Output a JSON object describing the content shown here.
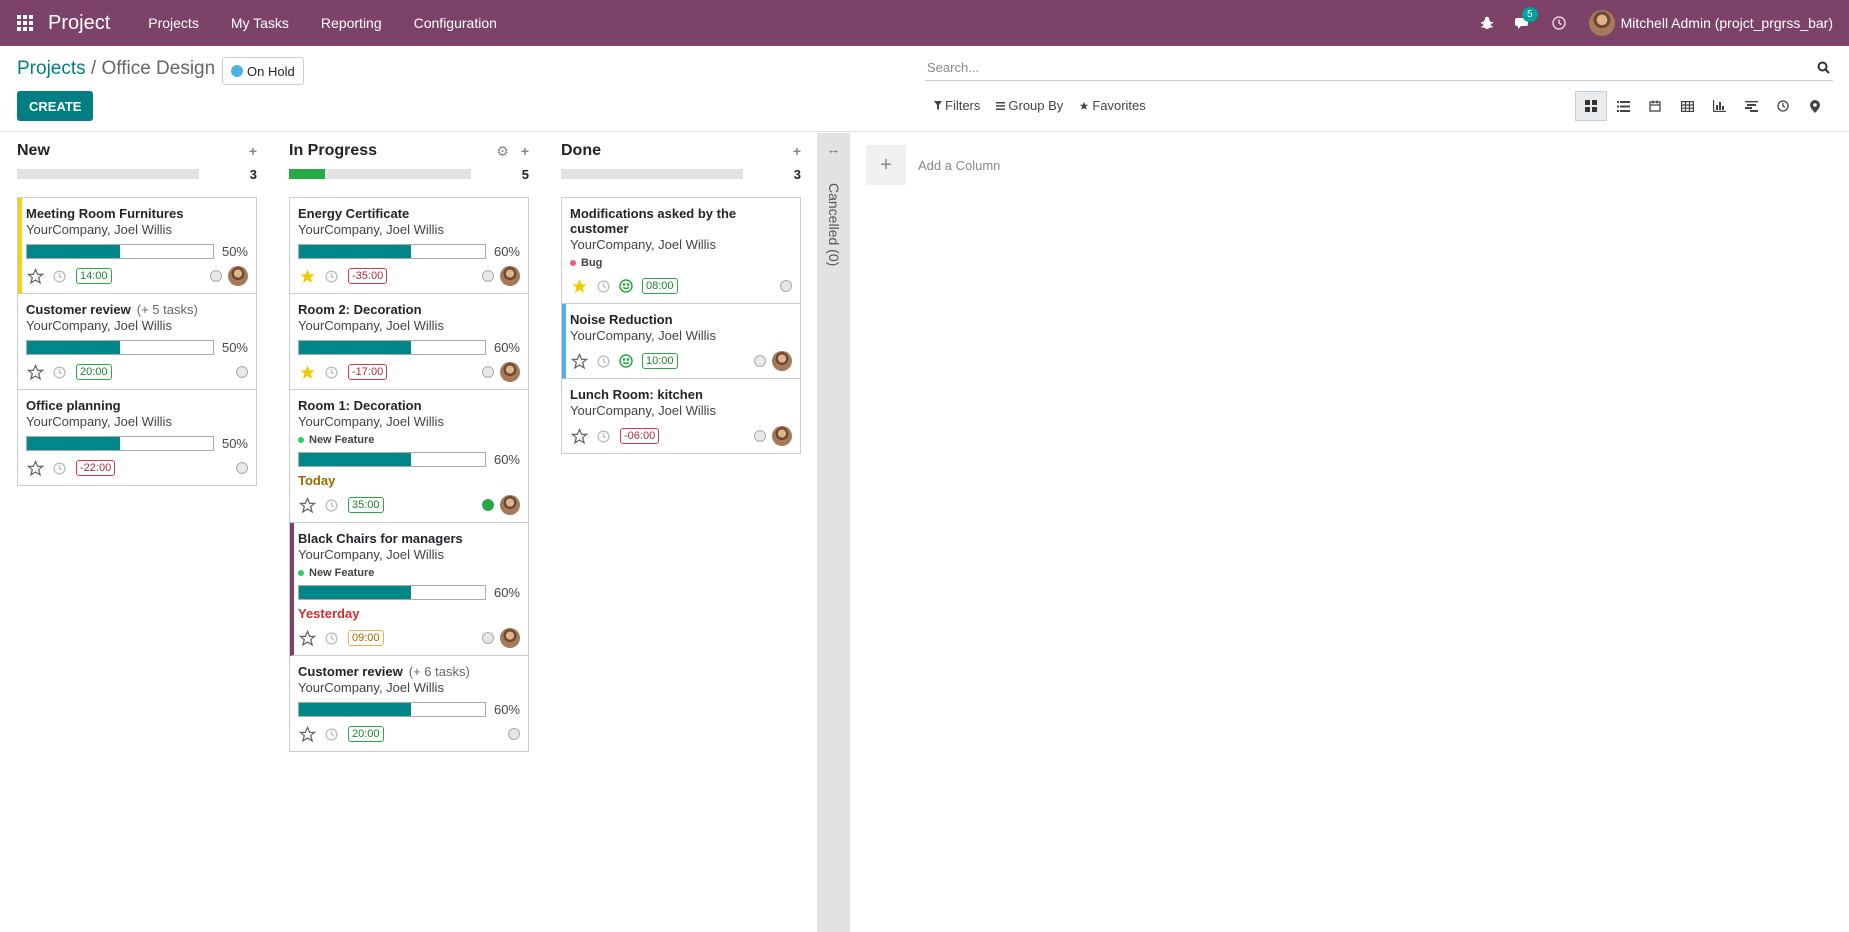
{
  "navbar": {
    "app_name": "Project",
    "menu": [
      "Projects",
      "My Tasks",
      "Reporting",
      "Configuration"
    ],
    "messages_count": "5",
    "user": "Mitchell Admin (projct_prgrss_bar)"
  },
  "control": {
    "breadcrumb_root": "Projects",
    "breadcrumb_sep": "/",
    "breadcrumb_current": "Office Design",
    "status": "On Hold",
    "create_label": "CREATE",
    "search_placeholder": "Search...",
    "filters_label": "Filters",
    "groupby_label": "Group By",
    "favorites_label": "Favorites"
  },
  "columns": [
    {
      "name": "New",
      "count": "3",
      "progress": 0,
      "cards": [
        {
          "title": "Meeting Room Furnitures",
          "sub": "",
          "partner": "YourCompany, Joel Willis",
          "progress": 50,
          "pct": "50%",
          "starred": false,
          "time": "14:00",
          "time_color": "green",
          "avatar": true,
          "accent": "yellow"
        },
        {
          "title": "Customer review",
          "sub": "(+ 5 tasks)",
          "partner": "YourCompany, Joel Willis",
          "progress": 50,
          "pct": "50%",
          "starred": false,
          "time": "20:00",
          "time_color": "green",
          "avatar": false
        },
        {
          "title": "Office planning",
          "sub": "",
          "partner": "YourCompany, Joel Willis",
          "progress": 50,
          "pct": "50%",
          "starred": false,
          "time": "-22:00",
          "time_color": "red",
          "avatar": false
        }
      ]
    },
    {
      "name": "In Progress",
      "count": "5",
      "progress": 20,
      "cards": [
        {
          "title": "Energy Certificate",
          "sub": "",
          "partner": "YourCompany, Joel Willis",
          "progress": 60,
          "pct": "60%",
          "starred": true,
          "time": "-35:00",
          "time_color": "red",
          "avatar": true
        },
        {
          "title": "Room 2: Decoration",
          "sub": "",
          "partner": "YourCompany, Joel Willis",
          "progress": 60,
          "pct": "60%",
          "starred": true,
          "time": "-17:00",
          "time_color": "red",
          "avatar": true
        },
        {
          "title": "Room 1: Decoration",
          "sub": "",
          "partner": "YourCompany, Joel Willis",
          "tag": "New Feature",
          "tag_color": "#2ecc71",
          "progress": 60,
          "pct": "60%",
          "deadline": "Today",
          "deadline_color": "#9a6a00",
          "starred": false,
          "time": "35:00",
          "time_color": "green",
          "state": "green",
          "avatar": true
        },
        {
          "title": "Black Chairs for managers",
          "sub": "",
          "partner": "YourCompany, Joel Willis",
          "tag": "New Feature",
          "tag_color": "#2ecc71",
          "progress": 60,
          "pct": "60%",
          "deadline": "Yesterday",
          "deadline_color": "#c9302c",
          "starred": false,
          "time": "09:00",
          "time_color": "orange",
          "avatar": true,
          "accent": "purple"
        },
        {
          "title": "Customer review",
          "sub": "(+ 6 tasks)",
          "partner": "YourCompany, Joel Willis",
          "progress": 60,
          "pct": "60%",
          "starred": false,
          "time": "20:00",
          "time_color": "green",
          "avatar": false
        }
      ]
    },
    {
      "name": "Done",
      "count": "3",
      "progress": 0,
      "cards": [
        {
          "title": "Modifications asked by the customer",
          "sub": "",
          "partner": "YourCompany, Joel Willis",
          "tag": "Bug",
          "tag_color": "#f06075",
          "starred": true,
          "smile": true,
          "time": "08:00",
          "time_color": "green",
          "avatar": false
        },
        {
          "title": "Noise Reduction",
          "sub": "",
          "partner": "YourCompany, Joel Willis",
          "starred": false,
          "smile": true,
          "time": "10:00",
          "time_color": "green",
          "avatar": true,
          "accent": "blue"
        },
        {
          "title": "Lunch Room: kitchen",
          "sub": "",
          "partner": "YourCompany, Joel Willis",
          "starred": false,
          "time": "-06:00",
          "time_color": "red",
          "avatar": true
        }
      ]
    }
  ],
  "folded": {
    "label": "Cancelled (0)"
  },
  "add_column_label": "Add a Column",
  "colors": {
    "brand": "#7c4268",
    "primary": "#017e84",
    "bar": "#00878a"
  }
}
